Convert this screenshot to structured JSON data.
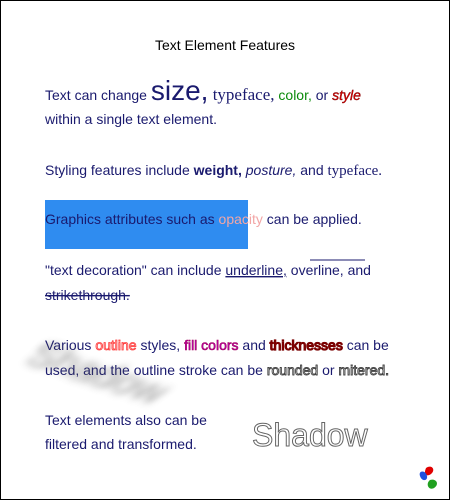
{
  "title": "Text Element Features",
  "colors": {
    "navy": "#1a1a6e",
    "green": "#0a8a0a",
    "red": "#e00000",
    "blue_box": "#2f8cf0",
    "opacity_text": "#f2a6a6",
    "outline_red": "#ff3b3b",
    "magenta": "#a0005a",
    "gray_text": "#ffffff",
    "border": "#000000"
  },
  "para1": {
    "lead": "Text can change ",
    "size": "size,",
    "typeface": " typeface,",
    "color": " color,",
    "or": " or ",
    "style": "style",
    "line2": "within a single text element."
  },
  "para2": {
    "lead": "Styling features include ",
    "weight": "weight,",
    "posture": " posture,",
    "and": " and ",
    "typeface": "typeface."
  },
  "para3": {
    "lead": "Graphics attributes such as ",
    "opacity": "opacity",
    "tail": " can be applied."
  },
  "para4": {
    "lead": "\"text decoration\" can include ",
    "underline": "underline,",
    "overline": " overline,",
    "and": " and",
    "strikethrough": "strikethrough."
  },
  "para5": {
    "lead": "Various ",
    "outline": "outline",
    "styles": " styles, ",
    "fill": "fill colors",
    "and": " and ",
    "thick": "thicknesses",
    "tail": " can be",
    "line2a": "used, and the outline stroke can be ",
    "rounded": "rounded",
    "or": " or ",
    "mitered": "mitered."
  },
  "para6": {
    "line1": "Text elements also can be",
    "line2": "filtered and transformed.",
    "shadow": "Shadow"
  },
  "logo_icon": "svg-logo-icon"
}
